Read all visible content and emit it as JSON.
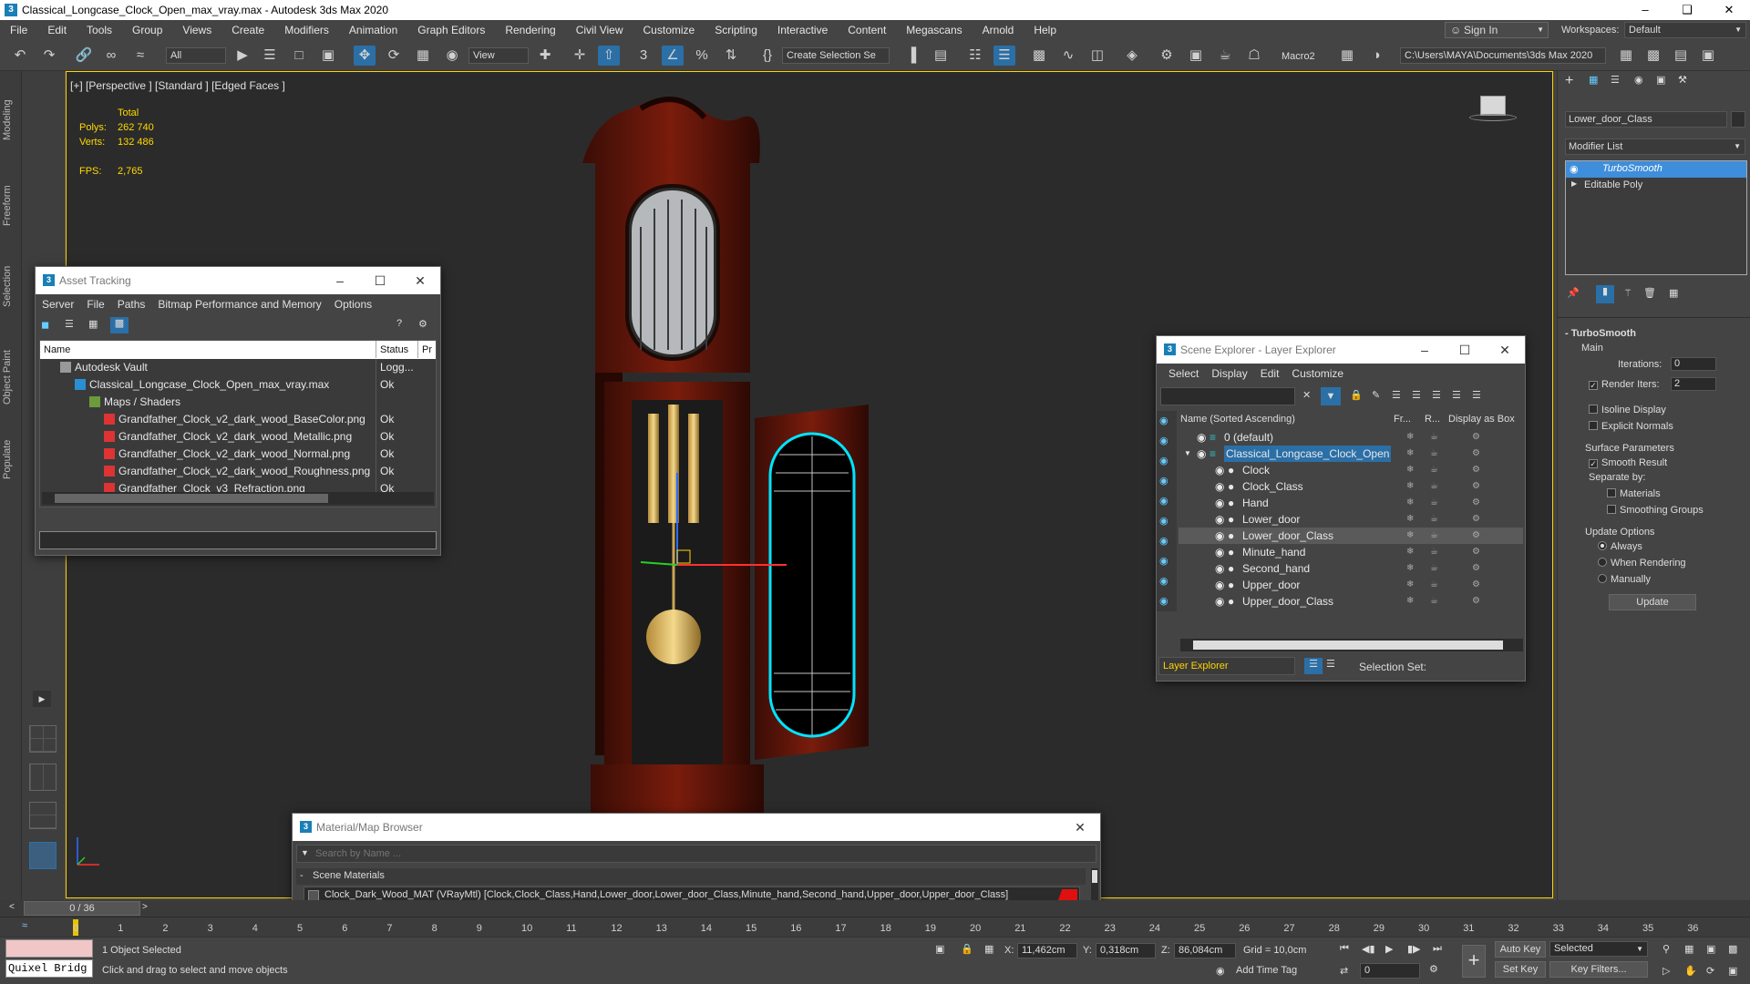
{
  "window": {
    "title": "Classical_Longcase_Clock_Open_max_vray.max - Autodesk 3ds Max 2020"
  },
  "menu": [
    "File",
    "Edit",
    "Tools",
    "Group",
    "Views",
    "Create",
    "Modifiers",
    "Animation",
    "Graph Editors",
    "Rendering",
    "Civil View",
    "Customize",
    "Scripting",
    "Interactive",
    "Content",
    "Megascans",
    "Arnold",
    "Help"
  ],
  "header": {
    "sign_in": "Sign In",
    "workspaces_label": "Workspaces:",
    "workspace": "Default"
  },
  "toolbar": {
    "filter": "All",
    "view": "View",
    "selection_set": "Create Selection Se",
    "macro": "Macro2",
    "project_path": "C:\\Users\\MAYA\\Documents\\3ds Max 2020"
  },
  "left_tabs": [
    "Modeling",
    "Freeform",
    "Selection",
    "Object Paint",
    "Populate"
  ],
  "viewport": {
    "label": "[+] [Perspective ] [Standard ] [Edged Faces ]",
    "stats": {
      "total_label": "Total",
      "polys_label": "Polys:",
      "polys": "262 740",
      "verts_label": "Verts:",
      "verts": "132 486",
      "fps_label": "FPS:",
      "fps": "2,765"
    }
  },
  "asset_tracking": {
    "title": "Asset Tracking",
    "menu": [
      "Server",
      "File",
      "Paths",
      "Bitmap Performance and Memory",
      "Options"
    ],
    "columns": [
      "Name",
      "Status",
      "Pr"
    ],
    "rows": [
      {
        "name": "Autodesk Vault",
        "status": "Logg...",
        "indent": 0,
        "icon": "vault-icon"
      },
      {
        "name": "Classical_Longcase_Clock_Open_max_vray.max",
        "status": "Ok",
        "indent": 1,
        "icon": "max-file-icon"
      },
      {
        "name": "Maps / Shaders",
        "status": "",
        "indent": 2,
        "icon": "maps-folder-icon"
      },
      {
        "name": "Grandfather_Clock_v2_dark_wood_BaseColor.png",
        "status": "Ok",
        "indent": 3,
        "icon": "bitmap-icon"
      },
      {
        "name": "Grandfather_Clock_v2_dark_wood_Metallic.png",
        "status": "Ok",
        "indent": 3,
        "icon": "bitmap-icon"
      },
      {
        "name": "Grandfather_Clock_v2_dark_wood_Normal.png",
        "status": "Ok",
        "indent": 3,
        "icon": "bitmap-icon"
      },
      {
        "name": "Grandfather_Clock_v2_dark_wood_Roughness.png",
        "status": "Ok",
        "indent": 3,
        "icon": "bitmap-icon"
      },
      {
        "name": "Grandfather_Clock_v3_Refraction.png",
        "status": "Ok",
        "indent": 3,
        "icon": "bitmap-icon"
      }
    ]
  },
  "scene_explorer": {
    "title": "Scene Explorer - Layer Explorer",
    "menu": [
      "Select",
      "Display",
      "Edit",
      "Customize"
    ],
    "columns": [
      "Name (Sorted Ascending)",
      "Fr...",
      "R...",
      "Display as Box"
    ],
    "rows": [
      {
        "name": "0 (default)",
        "indent": 1,
        "selected": false
      },
      {
        "name": "Classical_Longcase_Clock_Open",
        "indent": 1,
        "selected": false,
        "active": true
      },
      {
        "name": "Clock",
        "indent": 2,
        "selected": false
      },
      {
        "name": "Clock_Class",
        "indent": 2,
        "selected": false
      },
      {
        "name": "Hand",
        "indent": 2,
        "selected": false
      },
      {
        "name": "Lower_door",
        "indent": 2,
        "selected": false
      },
      {
        "name": "Lower_door_Class",
        "indent": 2,
        "selected": true
      },
      {
        "name": "Minute_hand",
        "indent": 2,
        "selected": false
      },
      {
        "name": "Second_hand",
        "indent": 2,
        "selected": false
      },
      {
        "name": "Upper_door",
        "indent": 2,
        "selected": false
      },
      {
        "name": "Upper_door_Class",
        "indent": 2,
        "selected": false
      }
    ],
    "footer_explorer": "Layer Explorer",
    "selection_set_label": "Selection Set:"
  },
  "material_browser": {
    "title": "Material/Map Browser",
    "search_placeholder": "Search by Name ...",
    "group": "Scene Materials",
    "material": "Clock_Dark_Wood_MAT (VRayMtl) [Clock,Clock_Class,Hand,Lower_door,Lower_door_Class,Minute_hand,Second_hand,Upper_door,Upper_door_Class]"
  },
  "command_panel": {
    "object_name": "Lower_door_Class",
    "modifier_list": "Modifier List",
    "stack": [
      "TurboSmooth",
      "Editable Poly"
    ],
    "rollout": "TurboSmooth",
    "main_label": "Main",
    "iterations_label": "Iterations:",
    "iterations": "0",
    "render_iters_label": "Render Iters:",
    "render_iters": "2",
    "isoline": "Isoline Display",
    "explicit": "Explicit Normals",
    "surface_params": "Surface Parameters",
    "smooth_result": "Smooth Result",
    "separate_by": "Separate by:",
    "materials": "Materials",
    "smoothing_groups": "Smoothing Groups",
    "update_options": "Update Options",
    "always": "Always",
    "when_rendering": "When Rendering",
    "manually": "Manually",
    "update_btn": "Update"
  },
  "timeline": {
    "frame": "0 / 36",
    "ticks": [
      "0",
      "1",
      "2",
      "3",
      "4",
      "5",
      "6",
      "7",
      "8",
      "9",
      "10",
      "11",
      "12",
      "13",
      "14",
      "15",
      "16",
      "17",
      "18",
      "19",
      "20",
      "21",
      "22",
      "23",
      "24",
      "25",
      "26",
      "27",
      "28",
      "29",
      "30",
      "31",
      "32",
      "33",
      "34",
      "35",
      "36"
    ]
  },
  "status": {
    "script_label": "Quixel Bridg",
    "selected": "1 Object Selected",
    "prompt": "Click and drag to select and move objects",
    "x_label": "X:",
    "x": "11,462cm",
    "y_label": "Y:",
    "y": "0,318cm",
    "z_label": "Z:",
    "z": "86,084cm",
    "grid": "Grid = 10,0cm",
    "add_time_tag": "Add Time Tag",
    "auto_key": "Auto Key",
    "set_key": "Set Key",
    "selected_dropdown": "Selected",
    "key_filters": "Key Filters...",
    "frame_field": "0"
  },
  "colors": {
    "selection_cyan": "#00e5ff",
    "viewport_border": "#ffd400",
    "highlight": "#2b6fa7",
    "stats_yellow": "#ffd900"
  }
}
